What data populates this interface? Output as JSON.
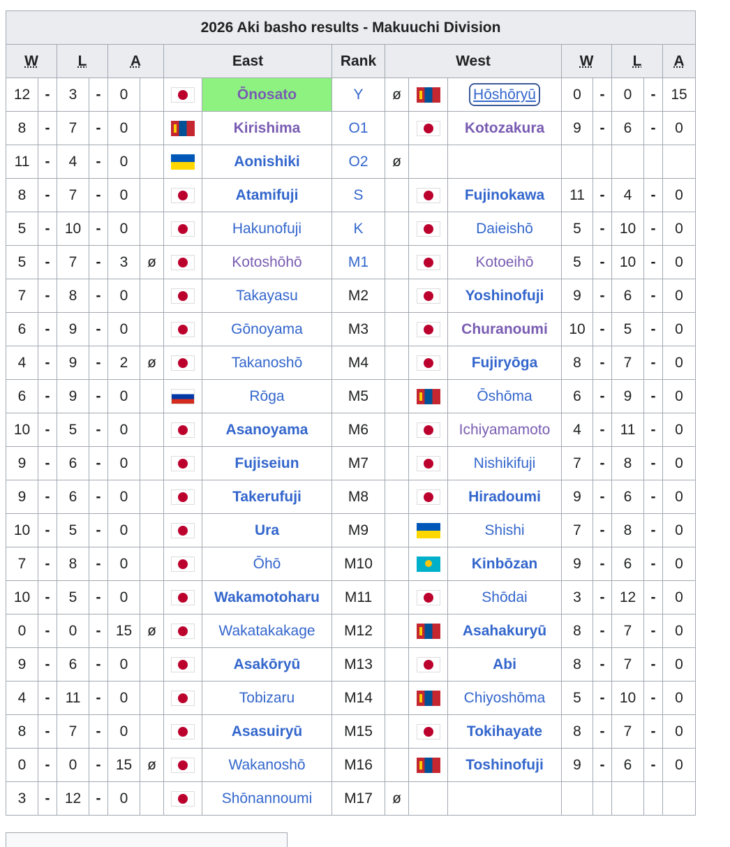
{
  "title": "2026 Aki basho results - Makuuchi Division",
  "headers": {
    "w": "W",
    "l": "L",
    "a": "A",
    "east": "East",
    "rank": "Rank",
    "west": "West"
  },
  "separator": "-",
  "absent_mark": "ø",
  "flags": {
    "jp": "Japan flag",
    "mn": "Mongolia flag",
    "ua": "Ukraine flag",
    "ru": "Russia flag",
    "kz": "Kazakhstan flag"
  },
  "rows": [
    {
      "ew": "12",
      "el": "3",
      "ea": "0",
      "ex": "",
      "ef": "jp",
      "en": "Ōnosato",
      "es": "bold-visited-highlight",
      "rank": "Y",
      "rl": true,
      "rx": "ø",
      "wf": "mn",
      "wn": "Hōshōryū",
      "ws": "boxed",
      "ww": "0",
      "wl": "0",
      "wa": "15"
    },
    {
      "ew": "8",
      "el": "7",
      "ea": "0",
      "ex": "",
      "ef": "mn",
      "en": "Kirishima",
      "es": "bold-visited",
      "rank": "O1",
      "rl": true,
      "rx": "",
      "wf": "jp",
      "wn": "Kotozakura",
      "ws": "bold-visited",
      "ww": "9",
      "wl": "6",
      "wa": "0"
    },
    {
      "ew": "11",
      "el": "4",
      "ea": "0",
      "ex": "",
      "ef": "ua",
      "en": "Aonishiki",
      "es": "bold",
      "rank": "O2",
      "rl": true,
      "rx": "ø",
      "wf": "",
      "wn": "",
      "ws": "",
      "ww": "",
      "wl": "",
      "wa": ""
    },
    {
      "ew": "8",
      "el": "7",
      "ea": "0",
      "ex": "",
      "ef": "jp",
      "en": "Atamifuji",
      "es": "bold",
      "rank": "S",
      "rl": true,
      "rx": "",
      "wf": "jp",
      "wn": "Fujinokawa",
      "ws": "bold",
      "ww": "11",
      "wl": "4",
      "wa": "0"
    },
    {
      "ew": "5",
      "el": "10",
      "ea": "0",
      "ex": "",
      "ef": "jp",
      "en": "Hakunofuji",
      "es": "",
      "rank": "K",
      "rl": true,
      "rx": "",
      "wf": "jp",
      "wn": "Daieishō",
      "ws": "",
      "ww": "5",
      "wl": "10",
      "wa": "0"
    },
    {
      "ew": "5",
      "el": "7",
      "ea": "3",
      "ex": "ø",
      "ef": "jp",
      "en": "Kotoshōhō",
      "es": "visited",
      "rank": "M1",
      "rl": true,
      "rx": "",
      "wf": "jp",
      "wn": "Kotoeihō",
      "ws": "visited",
      "ww": "5",
      "wl": "10",
      "wa": "0"
    },
    {
      "ew": "7",
      "el": "8",
      "ea": "0",
      "ex": "",
      "ef": "jp",
      "en": "Takayasu",
      "es": "",
      "rank": "M2",
      "rl": false,
      "rx": "",
      "wf": "jp",
      "wn": "Yoshinofuji",
      "ws": "bold",
      "ww": "9",
      "wl": "6",
      "wa": "0"
    },
    {
      "ew": "6",
      "el": "9",
      "ea": "0",
      "ex": "",
      "ef": "jp",
      "en": "Gōnoyama",
      "es": "",
      "rank": "M3",
      "rl": false,
      "rx": "",
      "wf": "jp",
      "wn": "Churanoumi",
      "ws": "bold-visited",
      "ww": "10",
      "wl": "5",
      "wa": "0"
    },
    {
      "ew": "4",
      "el": "9",
      "ea": "2",
      "ex": "ø",
      "ef": "jp",
      "en": "Takanoshō",
      "es": "",
      "rank": "M4",
      "rl": false,
      "rx": "",
      "wf": "jp",
      "wn": "Fujiryōga",
      "ws": "bold",
      "ww": "8",
      "wl": "7",
      "wa": "0"
    },
    {
      "ew": "6",
      "el": "9",
      "ea": "0",
      "ex": "",
      "ef": "ru",
      "en": "Rōga",
      "es": "",
      "rank": "M5",
      "rl": false,
      "rx": "",
      "wf": "mn",
      "wn": "Ōshōma",
      "ws": "",
      "ww": "6",
      "wl": "9",
      "wa": "0"
    },
    {
      "ew": "10",
      "el": "5",
      "ea": "0",
      "ex": "",
      "ef": "jp",
      "en": "Asanoyama",
      "es": "bold",
      "rank": "M6",
      "rl": false,
      "rx": "",
      "wf": "jp",
      "wn": "Ichiyamamoto",
      "ws": "visited",
      "ww": "4",
      "wl": "11",
      "wa": "0"
    },
    {
      "ew": "9",
      "el": "6",
      "ea": "0",
      "ex": "",
      "ef": "jp",
      "en": "Fujiseiun",
      "es": "bold",
      "rank": "M7",
      "rl": false,
      "rx": "",
      "wf": "jp",
      "wn": "Nishikifuji",
      "ws": "",
      "ww": "7",
      "wl": "8",
      "wa": "0"
    },
    {
      "ew": "9",
      "el": "6",
      "ea": "0",
      "ex": "",
      "ef": "jp",
      "en": "Takerufuji",
      "es": "bold",
      "rank": "M8",
      "rl": false,
      "rx": "",
      "wf": "jp",
      "wn": "Hiradoumi",
      "ws": "bold",
      "ww": "9",
      "wl": "6",
      "wa": "0"
    },
    {
      "ew": "10",
      "el": "5",
      "ea": "0",
      "ex": "",
      "ef": "jp",
      "en": "Ura",
      "es": "bold",
      "rank": "M9",
      "rl": false,
      "rx": "",
      "wf": "ua",
      "wn": "Shishi",
      "ws": "",
      "ww": "7",
      "wl": "8",
      "wa": "0"
    },
    {
      "ew": "7",
      "el": "8",
      "ea": "0",
      "ex": "",
      "ef": "jp",
      "en": "Ōhō",
      "es": "",
      "rank": "M10",
      "rl": false,
      "rx": "",
      "wf": "kz",
      "wn": "Kinbōzan",
      "ws": "bold",
      "ww": "9",
      "wl": "6",
      "wa": "0"
    },
    {
      "ew": "10",
      "el": "5",
      "ea": "0",
      "ex": "",
      "ef": "jp",
      "en": "Wakamotoharu",
      "es": "bold",
      "rank": "M11",
      "rl": false,
      "rx": "",
      "wf": "jp",
      "wn": "Shōdai",
      "ws": "",
      "ww": "3",
      "wl": "12",
      "wa": "0"
    },
    {
      "ew": "0",
      "el": "0",
      "ea": "15",
      "ex": "ø",
      "ef": "jp",
      "en": "Wakatakakage",
      "es": "",
      "rank": "M12",
      "rl": false,
      "rx": "",
      "wf": "mn",
      "wn": "Asahakuryū",
      "ws": "bold",
      "ww": "8",
      "wl": "7",
      "wa": "0"
    },
    {
      "ew": "9",
      "el": "6",
      "ea": "0",
      "ex": "",
      "ef": "jp",
      "en": "Asakōryū",
      "es": "bold",
      "rank": "M13",
      "rl": false,
      "rx": "",
      "wf": "jp",
      "wn": "Abi",
      "ws": "bold",
      "ww": "8",
      "wl": "7",
      "wa": "0"
    },
    {
      "ew": "4",
      "el": "11",
      "ea": "0",
      "ex": "",
      "ef": "jp",
      "en": "Tobizaru",
      "es": "",
      "rank": "M14",
      "rl": false,
      "rx": "",
      "wf": "mn",
      "wn": "Chiyoshōma",
      "ws": "",
      "ww": "5",
      "wl": "10",
      "wa": "0"
    },
    {
      "ew": "8",
      "el": "7",
      "ea": "0",
      "ex": "",
      "ef": "jp",
      "en": "Asasuiryū",
      "es": "bold",
      "rank": "M15",
      "rl": false,
      "rx": "",
      "wf": "jp",
      "wn": "Tokihayate",
      "ws": "bold",
      "ww": "8",
      "wl": "7",
      "wa": "0"
    },
    {
      "ew": "0",
      "el": "0",
      "ea": "15",
      "ex": "ø",
      "ef": "jp",
      "en": "Wakanoshō",
      "es": "",
      "rank": "M16",
      "rl": false,
      "rx": "",
      "wf": "mn",
      "wn": "Toshinofuji",
      "ws": "bold",
      "ww": "9",
      "wl": "6",
      "wa": "0"
    },
    {
      "ew": "3",
      "el": "12",
      "ea": "0",
      "ex": "",
      "ef": "jp",
      "en": "Shōnannoumi",
      "es": "",
      "rank": "M17",
      "rl": false,
      "rx": "ø",
      "wf": "",
      "wn": "",
      "ws": "",
      "ww": "",
      "wl": "",
      "wa": ""
    }
  ]
}
